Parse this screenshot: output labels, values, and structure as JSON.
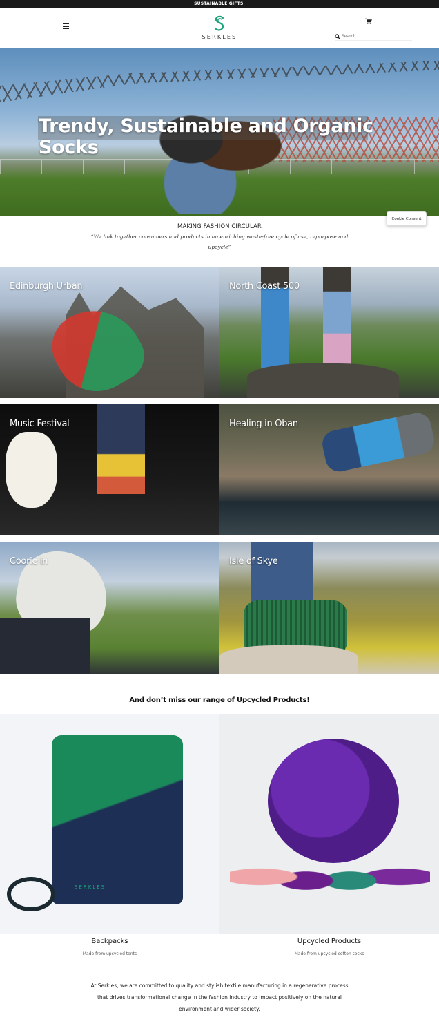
{
  "topbar": {
    "text": "SUSTAINABLE GIFTS|"
  },
  "header": {
    "logo_text": "SERKLES",
    "search_placeholder": "Search..."
  },
  "hero": {
    "title": "Trendy, Sustainable and Organic Socks"
  },
  "mission": {
    "title": "MAKING FASHION CIRCULAR",
    "quote": "“We link together consumers and products in an enriching waste-free cycle of use, repurpose and upcycle”"
  },
  "cookie": {
    "label": "Cookie Consent"
  },
  "collections": [
    {
      "label": "Edinburgh Urban"
    },
    {
      "label": "North Coast 500"
    },
    {
      "label": "Music Festival"
    },
    {
      "label": "Healing in Oban"
    },
    {
      "label": "Coorie in"
    },
    {
      "label": "Isle of Skye"
    }
  ],
  "upcycled": {
    "title": "And don’t miss our range of Upcycled Products!",
    "products": [
      {
        "name": "Backpacks",
        "desc": "Made from upcycled tents",
        "logo": "SERKLES"
      },
      {
        "name": "Upcycled Products",
        "desc": "Made from upcycled cotton socks"
      }
    ]
  },
  "about": {
    "text": "At Serkles, we are committed to quality and stylish textile manufacturing in a regenerative process that drives transformational change in the fashion industry to impact positively on the natural environment and wider society."
  },
  "colors": {
    "brand": "#1aa37a",
    "topbar": "#1a1a1a"
  }
}
